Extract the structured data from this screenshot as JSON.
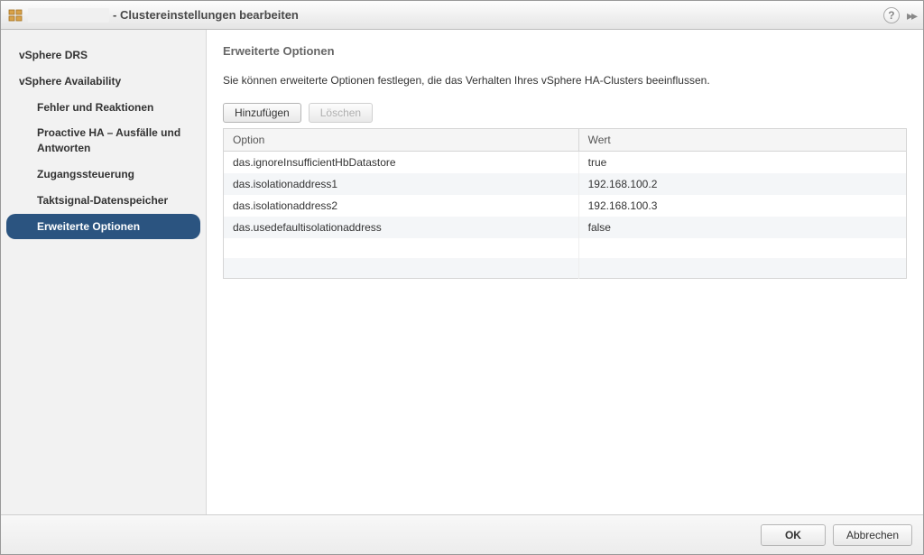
{
  "titlebar": {
    "suffix": "- Clustereinstellungen bearbeiten"
  },
  "sidebar": {
    "items": [
      {
        "label": "vSphere DRS",
        "level": "top",
        "selected": false
      },
      {
        "label": "vSphere Availability",
        "level": "top",
        "selected": false
      },
      {
        "label": "Fehler und Reaktionen",
        "level": "sub",
        "selected": false
      },
      {
        "label": "Proactive HA – Ausfälle und Antworten",
        "level": "sub",
        "selected": false
      },
      {
        "label": "Zugangssteuerung",
        "level": "sub",
        "selected": false
      },
      {
        "label": "Taktsignal-Datenspeicher",
        "level": "sub",
        "selected": false
      },
      {
        "label": "Erweiterte Optionen",
        "level": "sub",
        "selected": true
      }
    ]
  },
  "content": {
    "heading": "Erweiterte Optionen",
    "description": "Sie können erweiterte Optionen festlegen, die das Verhalten Ihres vSphere HA-Clusters beeinflussen.",
    "buttons": {
      "add": "Hinzufügen",
      "delete": "Löschen"
    },
    "table": {
      "columns": {
        "option": "Option",
        "wert": "Wert"
      },
      "rows": [
        {
          "option": "das.ignoreInsufficientHbDatastore",
          "wert": "true"
        },
        {
          "option": "das.isolationaddress1",
          "wert": "192.168.100.2"
        },
        {
          "option": "das.isolationaddress2",
          "wert": "192.168.100.3"
        },
        {
          "option": "das.usedefaultisolationaddress",
          "wert": "false"
        }
      ]
    }
  },
  "footer": {
    "ok": "OK",
    "cancel": "Abbrechen"
  }
}
